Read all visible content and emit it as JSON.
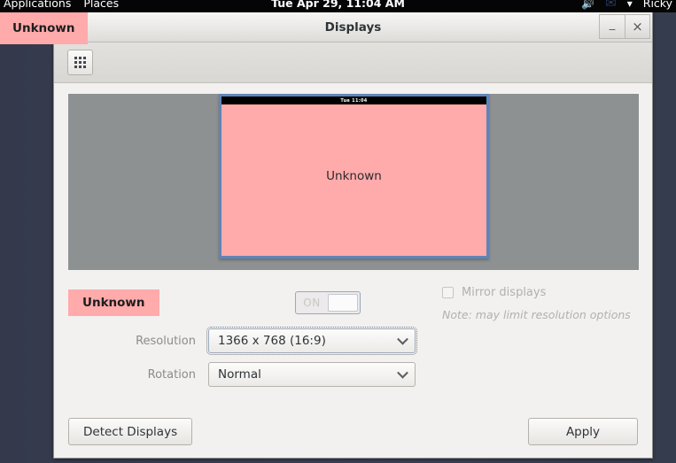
{
  "panel": {
    "applications": "Applications",
    "places": "Places",
    "clock": "Tue Apr 29, 11:04 AM",
    "volume_icon": "volume-icon",
    "mail_icon": "mail-icon",
    "network_icon": "network-icon",
    "user": "Ricky"
  },
  "float_badge": {
    "label": "Unknown"
  },
  "window": {
    "title": "Displays",
    "minimize_label": "_",
    "close_label": "×"
  },
  "toolbar": {
    "grid_icon": "grid-icon"
  },
  "preview": {
    "monitor": {
      "clock": "Tue 11:04",
      "label": "Unknown"
    }
  },
  "controls": {
    "output_name": "Unknown",
    "toggle": {
      "label": "ON",
      "state": "on"
    },
    "mirror": {
      "label": "Mirror displays",
      "checked": false,
      "note": "Note: may limit resolution options"
    },
    "resolution": {
      "label": "Resolution",
      "value": "1366 x 768 (16:9)"
    },
    "rotation": {
      "label": "Rotation",
      "value": "Normal"
    }
  },
  "footer": {
    "detect_label": "Detect Displays",
    "apply_label": "Apply"
  },
  "colors": {
    "accent_pink": "#ffaaab",
    "desktop": "#3a4155",
    "canvas_gray": "#8e9192",
    "monitor_border": "#5f85b8"
  }
}
